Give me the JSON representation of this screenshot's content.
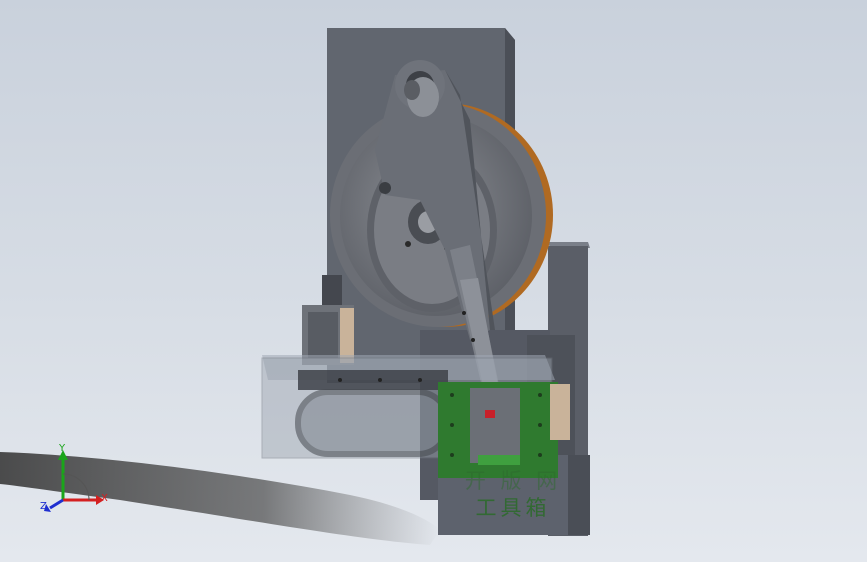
{
  "viewport": {
    "background_top": "#c9d1dc",
    "background_bottom": "#e4e8ee"
  },
  "model": {
    "plate_color": "#5d626d",
    "wheel_rim_color": "#b06a22",
    "pcb_color": "#2f7a2f",
    "watermark_line1": "开 版 网",
    "watermark_line2": "工具箱"
  },
  "triad": {
    "x_label": "X",
    "y_label": "Y",
    "z_label": "Z",
    "x_color": "#d42020",
    "y_color": "#1aa51a",
    "z_color": "#1f2fd0"
  }
}
